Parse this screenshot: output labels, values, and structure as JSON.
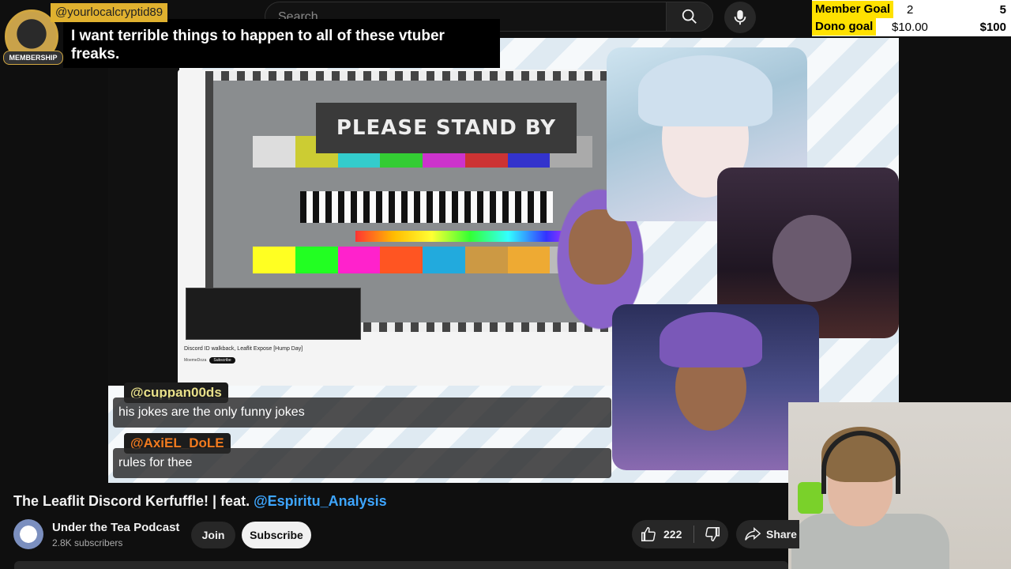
{
  "header": {
    "search_placeholder": "Search"
  },
  "goals": {
    "member_label": "Member Goal",
    "member_current": "2",
    "member_target": "5",
    "dono_label": "Dono goal",
    "dono_current": "$10.00",
    "dono_target": "$100"
  },
  "superchat": {
    "username": "@yourlocalcryptid89",
    "badge": "MEMBERSHIP",
    "message": "I want terrible things to happen to all of these vtuber freaks."
  },
  "stream": {
    "standby_text": "PLEASE STAND BY",
    "inner_video_title": "Discord ID walkback, Leaflit Expose [Hump Day]",
    "inner_channel": "MoemeDoza",
    "inner_subscribe": "Subscribe"
  },
  "chat": [
    {
      "user": "@cuppan00ds",
      "message": "his jokes are the only funny jokes",
      "color": "#e8e08a"
    },
    {
      "user": "@AxiEL_DoLE",
      "message": "rules for thee",
      "color": "#f07a1f"
    }
  ],
  "video": {
    "title_main": "The Leaflit Discord Kerfuffle! | feat. ",
    "title_mention": "@Espiritu_Analysis",
    "channel_name": "Under the Tea Podcast",
    "subscribers": "2.8K subscribers",
    "join_label": "Join",
    "subscribe_label": "Subscribe",
    "likes": "222",
    "share_label": "Share"
  },
  "icons": [
    "search-icon",
    "mic-icon",
    "like-icon",
    "dislike-icon",
    "share-icon"
  ],
  "colors": {
    "accent_link": "#3ea6ff",
    "superchat_gold": "#e0b12f",
    "goal_yellow": "#ffe100"
  }
}
